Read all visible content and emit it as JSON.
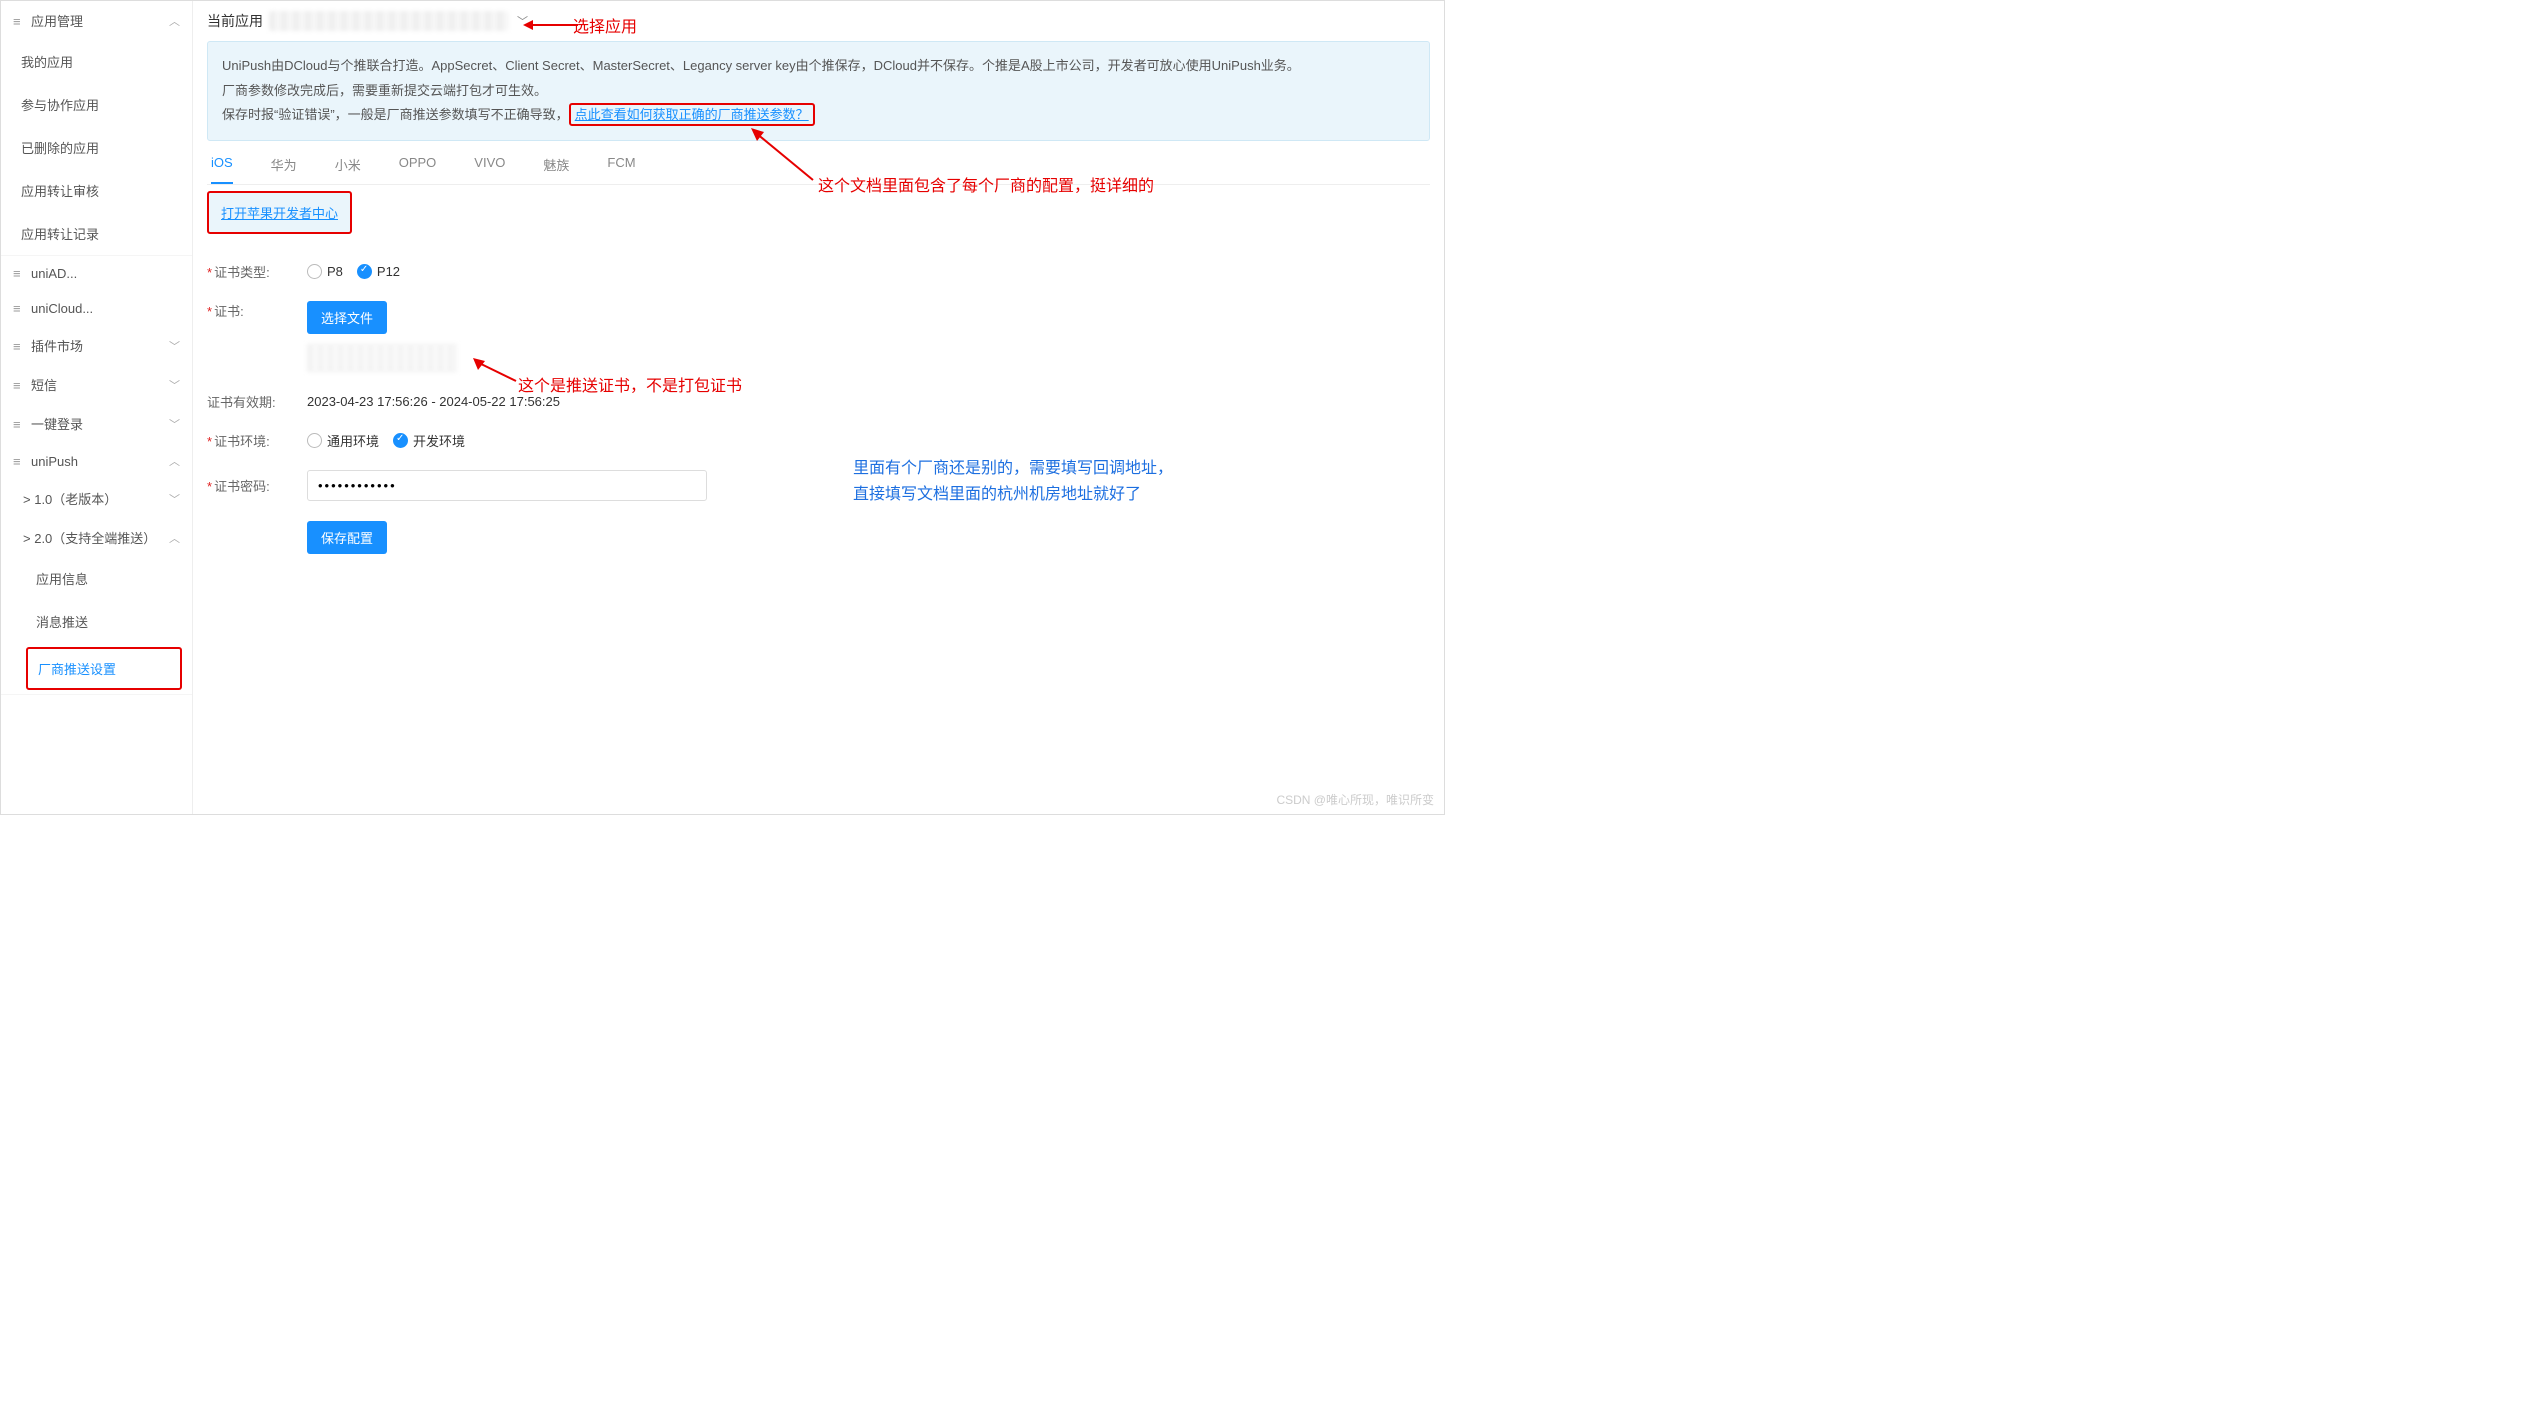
{
  "sidebar": {
    "group_app": {
      "title": "应用管理",
      "items": [
        "我的应用",
        "参与协作应用",
        "已删除的应用",
        "应用转让审核",
        "应用转让记录"
      ]
    },
    "uniAD": "uniAD...",
    "uniCloud": "uniCloud...",
    "pluginMarket": "插件市场",
    "sms": "短信",
    "oneClick": "一键登录",
    "uniPush": {
      "title": "uniPush",
      "v1": "1.0（老版本）",
      "v2": "2.0（支持全端推送）",
      "children": [
        "应用信息",
        "消息推送",
        "厂商推送设置"
      ]
    }
  },
  "topbar": {
    "label": "当前应用"
  },
  "infobox": {
    "line1": "UniPush由DCloud与个推联合打造。AppSecret、Client Secret、MasterSecret、Legancy server key由个推保存，DCloud并不保存。个推是A股上市公司，开发者可放心使用UniPush业务。",
    "line2": "厂商参数修改完成后，需要重新提交云端打包才可生效。",
    "line3a": "保存时报“验证错误”，一般是厂商推送参数填写不正确导致，",
    "link": "点此查看如何获取正确的厂商推送参数？"
  },
  "tabs": [
    "iOS",
    "华为",
    "小米",
    "OPPO",
    "VIVO",
    "魅族",
    "FCM"
  ],
  "active_tab": "iOS",
  "apple_link": "打开苹果开发者中心",
  "form": {
    "cert_type_label": "证书类型:",
    "cert_type_p8": "P8",
    "cert_type_p12": "P12",
    "cert_label": "证书:",
    "choose_file": "选择文件",
    "validity_label": "证书有效期:",
    "validity_value": "2023-04-23 17:56:26 - 2024-05-22 17:56:25",
    "env_label": "证书环境:",
    "env_general": "通用环境",
    "env_dev": "开发环境",
    "pw_label": "证书密码:",
    "pw_value": "••••••••••••",
    "save": "保存配置"
  },
  "annotations": {
    "select_app": "选择应用",
    "doc_note": "这个文档里面包含了每个厂商的配置，挺详细的",
    "cert_note": "这个是推送证书，不是打包证书",
    "callback_note1": "里面有个厂商还是别的，需要填写回调地址，",
    "callback_note2": "直接填写文档里面的杭州机房地址就好了"
  },
  "watermark": "CSDN @唯心所现，唯识所变"
}
